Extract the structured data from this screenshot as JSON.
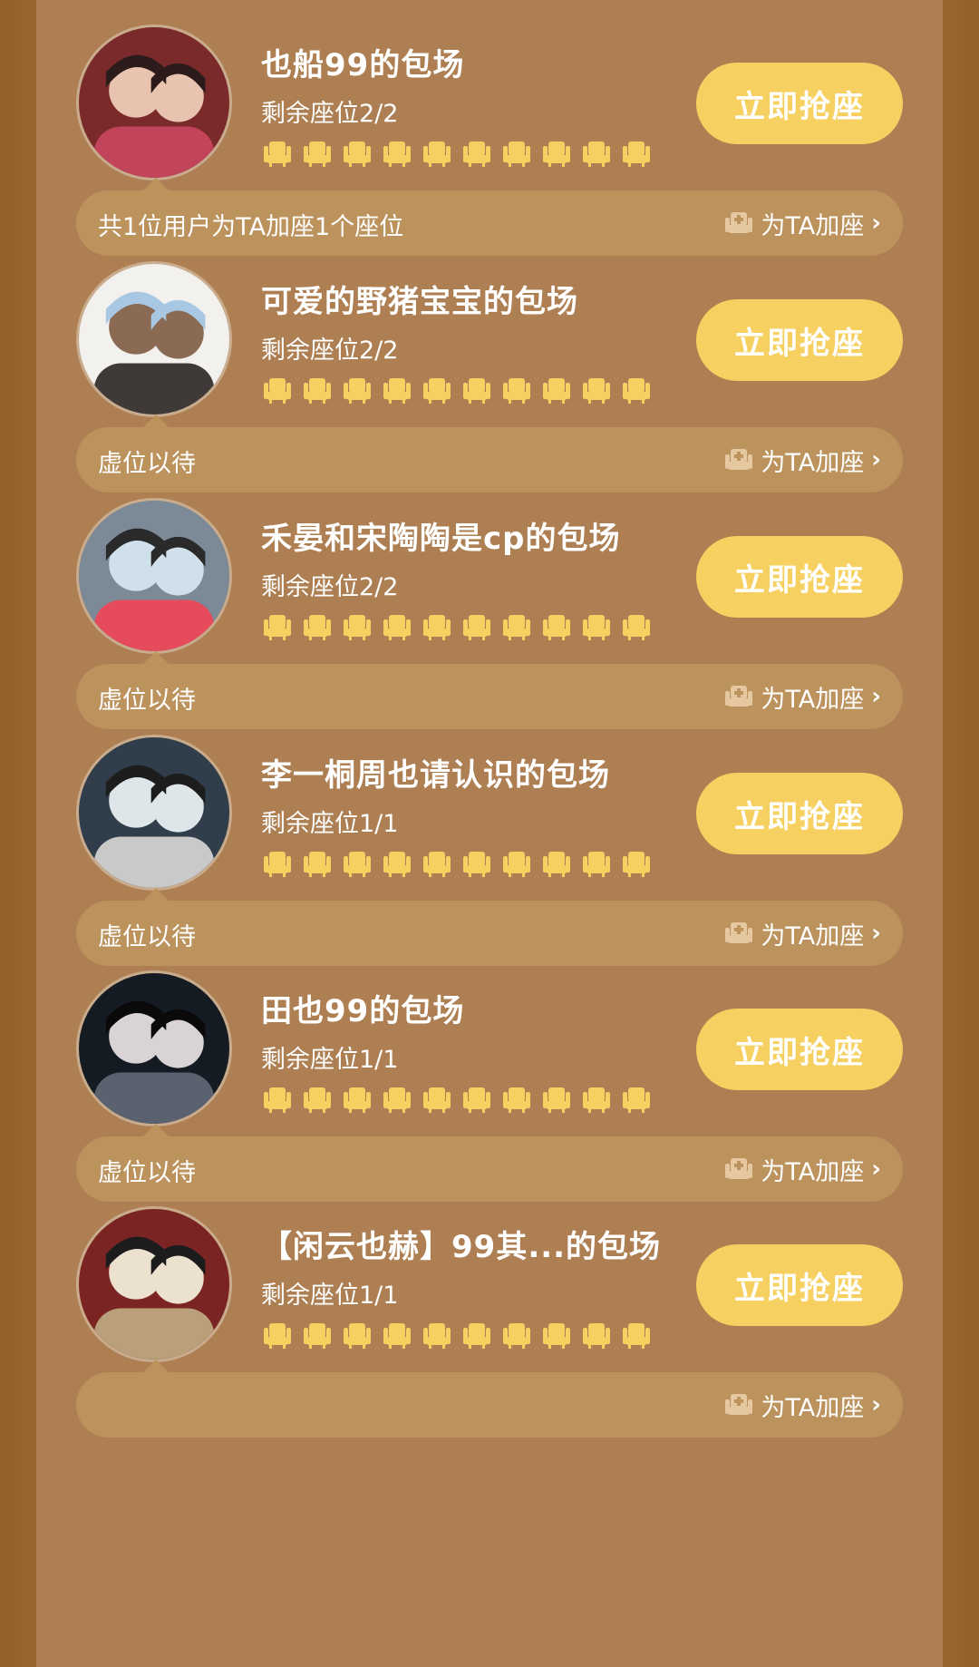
{
  "colors": {
    "background": "#ad7f52",
    "bar": "#bc925d",
    "button": "#f6d161",
    "seat": "#f6d161"
  },
  "sessions": [
    {
      "title": "也船99的包场",
      "remaining": "剩余座位2/2",
      "button_label": "立即抢座",
      "bar_text": "共1位用户为TA加座1个座位",
      "bar_blurred": false,
      "add_seat_label": "为TA加座",
      "seat_count": 10,
      "avatar_palette": [
        "#7a2a2a",
        "#e8c3b0",
        "#2b1b1b",
        "#c2445a"
      ]
    },
    {
      "title": "可爱的野猪宝宝的包场",
      "remaining": "剩余座位2/2",
      "button_label": "立即抢座",
      "bar_text": "虚位以待",
      "bar_blurred": false,
      "add_seat_label": "为TA加座",
      "seat_count": 10,
      "avatar_palette": [
        "#f3f1ee",
        "#8a6a52",
        "#a7c7e2",
        "#3f3a38"
      ]
    },
    {
      "title": "禾晏和宋陶陶是cp的包场",
      "remaining": "剩余座位2/2",
      "button_label": "立即抢座",
      "bar_text": "虚位以待",
      "bar_blurred": false,
      "add_seat_label": "为TA加座",
      "seat_count": 10,
      "avatar_palette": [
        "#7c8a98",
        "#cfe0ea",
        "#2a2a2a",
        "#e64b5b"
      ]
    },
    {
      "title": "李一桐周也请认识的包场",
      "remaining": "剩余座位1/1",
      "button_label": "立即抢座",
      "bar_text": "虚位以待",
      "bar_blurred": false,
      "add_seat_label": "为TA加座",
      "seat_count": 10,
      "avatar_palette": [
        "#2f3e4a",
        "#dfe6ea",
        "#1d1d1d",
        "#c9c9c9"
      ]
    },
    {
      "title": "田也99的包场",
      "remaining": "剩余座位1/1",
      "button_label": "立即抢座",
      "bar_text": "虚位以待",
      "bar_blurred": false,
      "add_seat_label": "为TA加座",
      "seat_count": 10,
      "avatar_palette": [
        "#151b22",
        "#d9d3d6",
        "#0a0a0a",
        "#5a6270"
      ]
    },
    {
      "title": "【闲云也赫】99其...的包场",
      "remaining": "剩余座位1/1",
      "button_label": "立即抢座",
      "bar_text": "",
      "bar_blurred": true,
      "add_seat_label": "为TA加座",
      "seat_count": 10,
      "avatar_palette": [
        "#7a2424",
        "#ece0cf",
        "#1c1c1c",
        "#b9a07a"
      ]
    }
  ]
}
